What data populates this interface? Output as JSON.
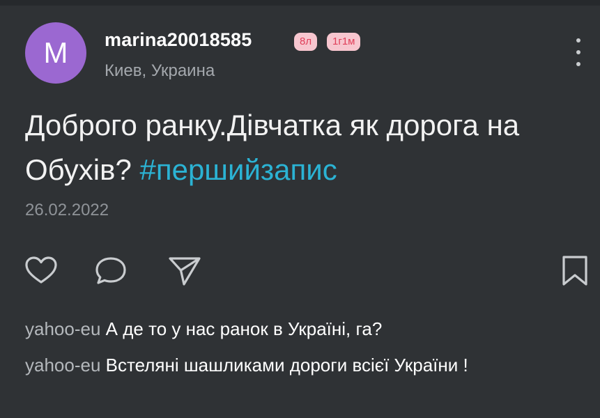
{
  "post": {
    "avatar_letter": "M",
    "username": "marina20018585",
    "badges": [
      "8л",
      "1г1м"
    ],
    "location": "Киев, Украина",
    "text": "Доброго ранку.Дівчатка як дорога на Обухів? ",
    "hashtag": "#першийзапис",
    "date": "26.02.2022",
    "colors": {
      "background": "#2f3235",
      "avatar": "#9b68d1",
      "hashtag": "#2bb3d4",
      "badge_bg": "#f7c6cf",
      "badge_text": "#e0405a"
    },
    "icons": {
      "like": "heart-icon",
      "comment": "speech-bubble-icon",
      "share": "paper-plane-icon",
      "bookmark": "bookmark-icon",
      "more": "vertical-dots-icon"
    }
  },
  "comments": [
    {
      "author": "yahoo-eu",
      "text": "А де то у нас ранок в Україні, га?"
    },
    {
      "author": "yahoo-eu",
      "text": "Вcтеляні шашликами дороги всієї України !"
    }
  ]
}
